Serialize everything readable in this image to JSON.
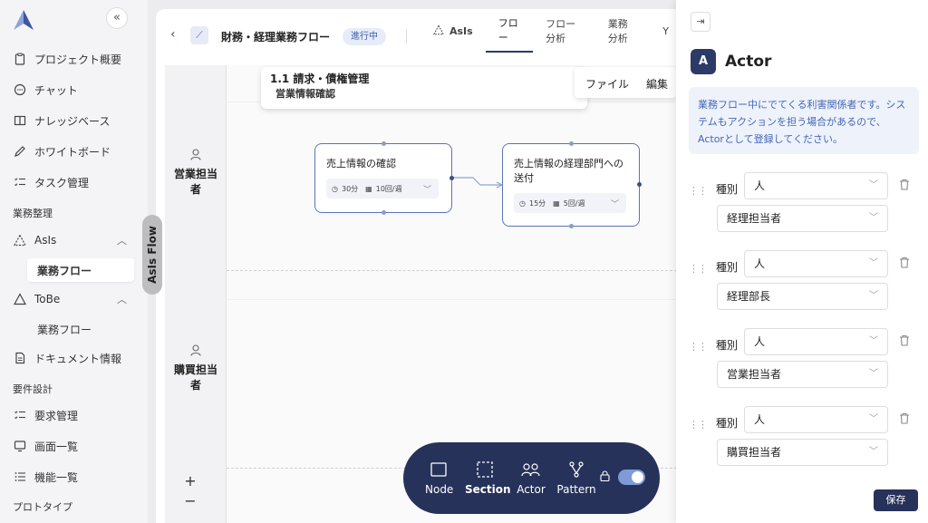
{
  "sidebar": {
    "collapse_label": "«",
    "items": [
      {
        "label": "プロジェクト概要"
      },
      {
        "label": "チャット"
      },
      {
        "label": "ナレッジベース"
      },
      {
        "label": "ホワイトボード"
      },
      {
        "label": "タスク管理"
      }
    ],
    "section_gyomu": "業務整理",
    "asis": {
      "label": "AsIs",
      "sub": "業務フロー"
    },
    "tobe": {
      "label": "ToBe",
      "sub": "業務フロー"
    },
    "document": "ドキュメント情報",
    "section_req": "要件設計",
    "req_items": [
      {
        "label": "要求管理"
      },
      {
        "label": "画面一覧"
      },
      {
        "label": "機能一覧"
      }
    ],
    "section_proto": "プロトタイプ"
  },
  "side_tab": {
    "label": "AsIs Flow"
  },
  "header": {
    "back": "‹",
    "title": "財務・経理業務フロー",
    "status": "進行中",
    "tabs": [
      {
        "label": "AsIs"
      },
      {
        "label": "フロー"
      },
      {
        "label": "フロー分析"
      },
      {
        "label": "業務分析"
      },
      {
        "label": "Y"
      }
    ]
  },
  "canvas": {
    "section_title": "1.1 請求・債権管理",
    "section_sub": "営業情報確認",
    "menu": {
      "file": "ファイル",
      "edit": "編集"
    },
    "lanes": [
      {
        "label": "営業担当者"
      },
      {
        "label": "購買担当者"
      }
    ],
    "nodes": [
      {
        "title": "売上情報の確認",
        "time": "30分",
        "freq": "10回/週"
      },
      {
        "title": "売上情報の経理部門への送付",
        "time": "15分",
        "freq": "5回/週"
      }
    ],
    "zoom_in": "+",
    "zoom_out": "−"
  },
  "toolbar": {
    "items": [
      {
        "label": "Node"
      },
      {
        "label": "Section"
      },
      {
        "label": "Actor"
      },
      {
        "label": "Pattern"
      }
    ],
    "toggle_on": true
  },
  "panel": {
    "close": "⇥",
    "avatar": "A",
    "title": "Actor",
    "description": "業務フロー中にでてくる利害関係者です。システムもアクションを担う場合があるので、Actorとして登録してください。",
    "type_label": "種別",
    "actors": [
      {
        "type": "人",
        "name": "経理担当者"
      },
      {
        "type": "人",
        "name": "経理部長"
      },
      {
        "type": "人",
        "name": "営業担当者"
      },
      {
        "type": "人",
        "name": "購買担当者"
      }
    ],
    "save": "保存"
  },
  "colors": {
    "brand_dark": "#26325a",
    "accent": "#4467b4",
    "node_border": "#5b74b6"
  }
}
